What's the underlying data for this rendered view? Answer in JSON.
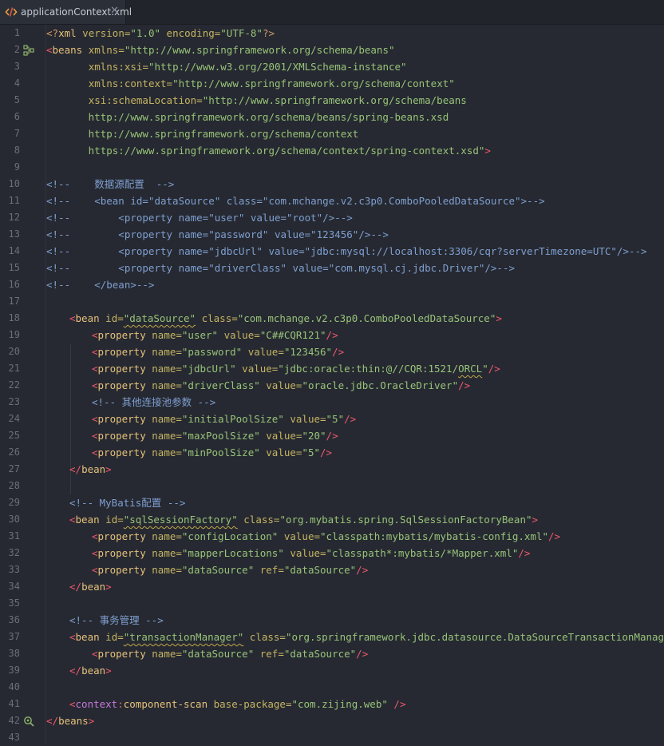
{
  "tab": {
    "filename": "applicationContext.xml",
    "file_icon": "xml-file-icon",
    "close_icon": "close-icon"
  },
  "gutter_icons": {
    "line2": "bean-structure-icon",
    "line41": "component-scan-icon"
  },
  "lines": [
    "1",
    "2",
    "3",
    "4",
    "5",
    "6",
    "7",
    "8",
    "9",
    "10",
    "11",
    "12",
    "13",
    "14",
    "15",
    "16",
    "17",
    "18",
    "19",
    "20",
    "21",
    "22",
    "23",
    "24",
    "25",
    "26",
    "27",
    "28",
    "29",
    "30",
    "31",
    "32",
    "33",
    "34",
    "35",
    "36",
    "37",
    "38",
    "39",
    "40",
    "41",
    "42",
    "43"
  ],
  "code": {
    "l1": {
      "open": "<?",
      "name": "xml",
      "version_attr": " version=",
      "version_val": "\"1.0\"",
      "enc_attr": " encoding=",
      "enc_val": "\"UTF-8\"",
      "close": "?>"
    },
    "l2": {
      "open": "<",
      "name": "beans",
      "attr": " xmlns=",
      "val": "\"http://www.springframework.org/schema/beans\""
    },
    "l3": {
      "indent": "       ",
      "prefix": "xmlns",
      "sep": ":",
      "local": "xsi",
      "eq": "=",
      "val": "\"http://www.w3.org/2001/XMLSchema-instance\""
    },
    "l4": {
      "indent": "       ",
      "prefix": "xmlns",
      "sep": ":",
      "local": "context",
      "eq": "=",
      "val": "\"http://www.springframework.org/schema/context\""
    },
    "l5": {
      "indent": "       ",
      "prefix": "xsi",
      "sep": ":",
      "local": "schemaLocation",
      "eq": "=",
      "val": "\"http://www.springframework.org/schema/beans"
    },
    "l6": {
      "text": "       http://www.springframework.org/schema/beans/spring-beans.xsd"
    },
    "l7": {
      "text": "       http://www.springframework.org/schema/context"
    },
    "l8": {
      "text": "       https://www.springframework.org/schema/context/spring-context.xsd\"",
      "close": ">"
    },
    "l10": "<!--    数据源配置  -->",
    "l11": "<!--    <bean id=\"dataSource\" class=\"com.mchange.v2.c3p0.ComboPooledDataSource\">-->",
    "l12": "<!--        <property name=\"user\" value=\"root\"/>-->",
    "l13": "<!--        <property name=\"password\" value=\"123456\"/>-->",
    "l14": "<!--        <property name=\"jdbcUrl\" value=\"jdbc:mysql://localhost:3306/cqr?serverTimezone=UTC\"/>-->",
    "l15": "<!--        <property name=\"driverClass\" value=\"com.mysql.cj.jdbc.Driver\"/>-->",
    "l16": "<!--    </bean>-->",
    "l18": {
      "id": "\"dataSource\"",
      "class": "\"com.mchange.v2.c3p0.ComboPooledDataSource\""
    },
    "l19": {
      "name": "\"user\"",
      "value": "\"C##CQR121\""
    },
    "l20": {
      "name": "\"password\"",
      "value": "\"123456\""
    },
    "l21": {
      "name": "\"jdbcUrl\"",
      "value_pre": "\"jdbc:oracle:thin:@//CQR:1521/",
      "value_sq": "ORCL",
      "value_post": "\""
    },
    "l22": {
      "name": "\"driverClass\"",
      "value": "\"oracle.jdbc.OracleDriver\""
    },
    "l23": "<!-- 其他连接池参数 -->",
    "l24": {
      "name": "\"initialPoolSize\"",
      "value": "\"5\""
    },
    "l25": {
      "name": "\"maxPoolSize\"",
      "value": "\"20\""
    },
    "l26": {
      "name": "\"minPoolSize\"",
      "value": "\"5\""
    },
    "l29": "<!-- MyBatis配置 -->",
    "l30": {
      "id": "\"sqlSessionFactory\"",
      "class": "\"org.mybatis.spring.SqlSessionFactoryBean\""
    },
    "l31": {
      "name": "\"configLocation\"",
      "value": "\"classpath:mybatis/mybatis-config.xml\""
    },
    "l32": {
      "name": "\"mapperLocations\"",
      "value": "\"classpath*:mybatis/*Mapper.xml\""
    },
    "l33": {
      "name": "\"dataSource\"",
      "ref": "\"dataSource\""
    },
    "l36": "<!-- 事务管理 -->",
    "l37": {
      "id": "\"transactionManager\"",
      "class": "\"org.springframework.jdbc.datasource.DataSourceTransactionManager\""
    },
    "l38": {
      "name": "\"dataSource\"",
      "ref": "\"dataSource\""
    },
    "l41": {
      "prefix": "context",
      "sep": ":",
      "local": "component-scan",
      "attr": " base-package=",
      "val": "\"com.zijing.web\""
    }
  },
  "tokens": {
    "lt": "<",
    "gt": ">",
    "sgt": "/>",
    "self_close": " />",
    "lt_slash": "</",
    "bean": "bean",
    "beans": "beans",
    "property": "property",
    "id_attr": " id=",
    "class_attr": " class=",
    "name_attr": " name=",
    "value_attr": " value=",
    "ref_attr": " ref="
  },
  "colors": {
    "background": "#262931",
    "tag": "#e5c07b",
    "bracket": "#ef596f",
    "attribute": "#c5b463",
    "namespace": "#c678dd",
    "value": "#98c379",
    "comment": "#7f9fd1",
    "line_number": "#6a6f7a"
  }
}
